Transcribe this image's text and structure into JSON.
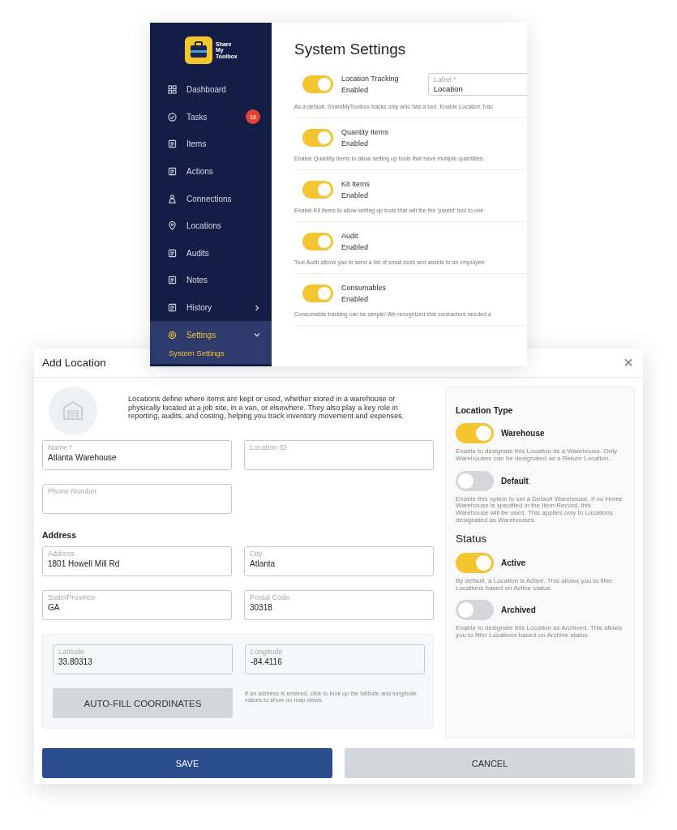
{
  "settings_window": {
    "logo": {
      "text": "Share My Toolbox"
    },
    "sidebar": {
      "items": [
        {
          "label": "Dashboard",
          "selected": false
        },
        {
          "label": "Tasks",
          "selected": false,
          "badge": "18"
        },
        {
          "label": "Items",
          "selected": false
        },
        {
          "label": "Actions",
          "selected": false
        },
        {
          "label": "Connections",
          "selected": false
        },
        {
          "label": "Locations",
          "selected": false
        },
        {
          "label": "Audits",
          "selected": false
        },
        {
          "label": "Notes",
          "selected": false
        },
        {
          "label": "History",
          "selected": false,
          "expanded": false
        },
        {
          "label": "Settings",
          "selected": true,
          "expanded": true,
          "children": [
            {
              "label": "System Settings",
              "selected": true
            }
          ]
        }
      ]
    },
    "title": "System Settings",
    "settings": [
      {
        "name": "Location Tracking",
        "status": "Enabled",
        "on": true,
        "field": {
          "label": "Label *",
          "value": "Location"
        },
        "description": "As a default, ShareMyToolbox tracks only who has a tool. Enable Location Trac"
      },
      {
        "name": "Quantity Items",
        "status": "Enabled",
        "on": true,
        "description": "Enable Quantity Items to allow setting up tools that have multiple quantities."
      },
      {
        "name": "Kit Items",
        "status": "Enabled",
        "on": true,
        "description": "Enable Kit Items to allow setting up tools that will the the 'parent' tool to one"
      },
      {
        "name": "Audit",
        "status": "Enabled",
        "on": true,
        "description": "Tool Audit allows you to send a list of small tools and assets to an employee"
      },
      {
        "name": "Consumables",
        "status": "Enabled",
        "on": true,
        "description": "Consumable tracking can be simple! We recognized that contractors needed a"
      }
    ]
  },
  "dialog": {
    "title": "Add Location",
    "close": "×",
    "intro": "Locations define where items are kept or used, whether stored in a warehouse or physically located at a job site, in a van, or elsewhere. They also play a key role in reporting, audits, and costing, helping you track inventory movement and expenses.",
    "fields": [
      {
        "label": "Name *",
        "value": "Atlanta Warehouse"
      },
      {
        "label": "Location ID"
      },
      {
        "label": "Phone Number"
      }
    ],
    "address_heading": "Address",
    "address_fields": [
      {
        "label": "Address",
        "value": "1801 Howell Mill Rd"
      },
      {
        "label": "City",
        "value": "Atlanta"
      },
      {
        "label": "State/Province",
        "value": "GA"
      },
      {
        "label": "Postal Code",
        "value": "30318"
      }
    ],
    "coordinates": {
      "fields": [
        {
          "label": "Latitude",
          "value": "33.80313"
        },
        {
          "label": "Longitude",
          "value": "-84.4116"
        }
      ],
      "button": "AUTO-FILL COORDINATES",
      "help": "If an address is entered, click to look up the latitude and longitude values to show on map views."
    },
    "side_panel": [
      {
        "heading": "Location Type",
        "toggles": [
          {
            "label": "Warehouse",
            "on": true,
            "description": "Enable to designate this Location as a Warehouse. Only Warehouses can be designated as a Return Location."
          },
          {
            "label": "Default",
            "on": false,
            "description": "Enable this option to set a Default Warehouse. If no Home Warehouse is specified in the Item Record, this Warehouse will be used. This applies only to Locations designated as Warehouses."
          }
        ]
      },
      {
        "heading": "Status",
        "toggles": [
          {
            "label": "Active",
            "on": true,
            "description": "By default, a Location is Active. This allows you to filter Locations based on Active status."
          },
          {
            "label": "Archived",
            "on": false,
            "description": "Enable to designate this Location as Archived. This allows you to filter Locations based on Archive status."
          }
        ]
      }
    ],
    "buttons": [
      {
        "label": "SAVE",
        "kind": "primary"
      },
      {
        "label": "CANCEL",
        "kind": "secondary"
      }
    ]
  }
}
